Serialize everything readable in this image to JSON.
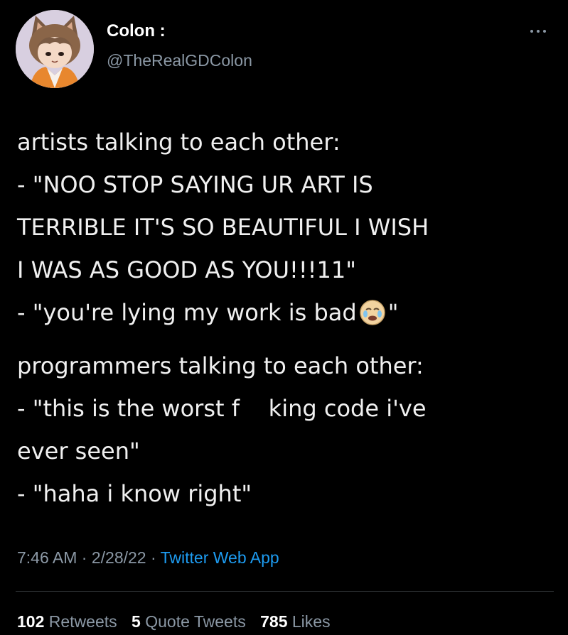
{
  "user": {
    "display_name": "Colon :",
    "handle": "@TheRealGDColon",
    "avatar_icon": "cat-girl-avatar-icon"
  },
  "tweet": {
    "lines": [
      "artists talking to each other:",
      "- \"NOO STOP SAYING UR ART IS",
      "TERRIBLE IT'S SO BEAUTIFUL I WISH",
      "I WAS AS GOOD AS YOU!!!11\"",
      "- \"you're lying my work is bad",
      "\"",
      "programmers talking to each other:",
      "- \"this is the worst f    king code i've",
      "ever seen\"",
      "- \"haha i know right\""
    ],
    "emoji_icon": "crying-face-emoji-icon"
  },
  "meta": {
    "time": "7:46 AM",
    "sep1": " · ",
    "date": "2/28/22",
    "sep2": " · ",
    "source": "Twitter Web App"
  },
  "stats": {
    "retweets_count": "102",
    "retweets_label": "Retweets",
    "quotes_count": "5",
    "quotes_label": "Quote Tweets",
    "likes_count": "785",
    "likes_label": "Likes"
  },
  "colors": {
    "background": "#000000",
    "text": "#e7e9ea",
    "secondary": "#8b98a5",
    "link": "#1d9bf0"
  }
}
